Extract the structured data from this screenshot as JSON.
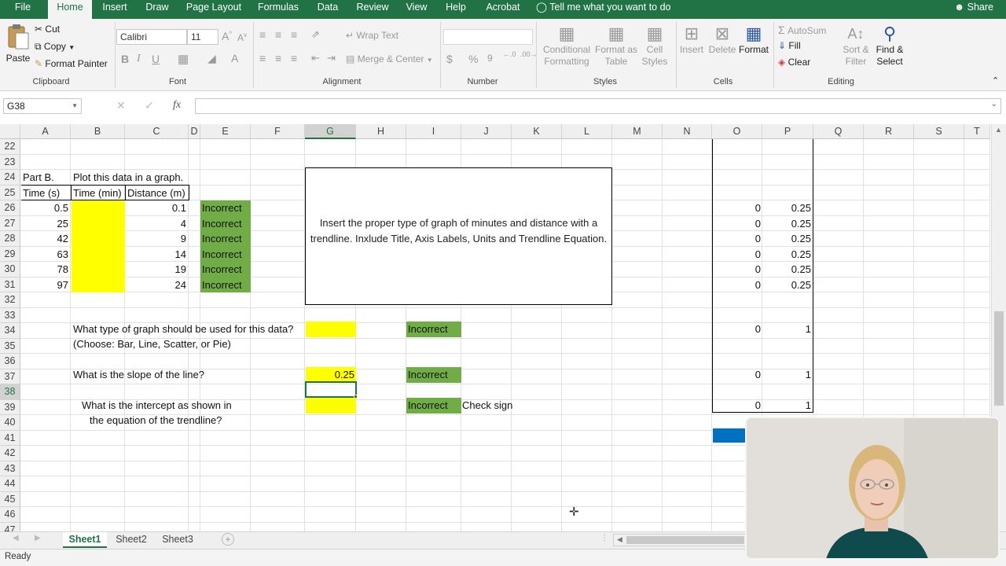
{
  "menu": {
    "tabs": [
      "File",
      "Home",
      "Insert",
      "Draw",
      "Page Layout",
      "Formulas",
      "Data",
      "Review",
      "View",
      "Help",
      "Acrobat"
    ],
    "active_tab": "Home",
    "tell_me": "Tell me what you want to do",
    "share": "Share"
  },
  "ribbon": {
    "clipboard": {
      "paste": "Paste",
      "cut": "Cut",
      "copy": "Copy",
      "format_painter": "Format Painter",
      "label": "Clipboard"
    },
    "font": {
      "name": "Calibri",
      "size": "11",
      "bold": "B",
      "italic": "I",
      "underline": "U",
      "label": "Font"
    },
    "alignment": {
      "wrap_text": "Wrap Text",
      "merge_center": "Merge & Center",
      "label": "Alignment"
    },
    "number": {
      "format": "",
      "currency": "$",
      "percent": "%",
      "comma": "9",
      "label": "Number"
    },
    "styles": {
      "conditional_1": "Conditional",
      "conditional_2": "Formatting",
      "format_as_1": "Format as",
      "format_as_2": "Table",
      "cell_styles_1": "Cell",
      "cell_styles_2": "Styles",
      "label": "Styles"
    },
    "cells": {
      "insert": "Insert",
      "delete": "Delete",
      "format": "Format",
      "label": "Cells"
    },
    "editing": {
      "autosum": "AutoSum",
      "fill": "Fill",
      "clear": "Clear",
      "sort_1": "Sort &",
      "sort_2": "Filter",
      "find_1": "Find &",
      "find_2": "Select",
      "label": "Editing"
    }
  },
  "formula_bar": {
    "name_box": "G38",
    "fx": "fx",
    "formula": ""
  },
  "columns": [
    "A",
    "B",
    "C",
    "D",
    "E",
    "F",
    "G",
    "H",
    "I",
    "J",
    "K",
    "L",
    "M",
    "N",
    "O",
    "P",
    "Q",
    "R",
    "S",
    "T"
  ],
  "selected_column": "G",
  "rows": [
    "22",
    "23",
    "24",
    "25",
    "26",
    "27",
    "28",
    "29",
    "30",
    "31",
    "32",
    "33",
    "34",
    "35",
    "36",
    "37",
    "38",
    "39",
    "40",
    "41",
    "42",
    "43",
    "44",
    "45",
    "46",
    "47"
  ],
  "selected_row": "38",
  "cells": {
    "a24": "Part B.",
    "b24": "Plot this data in a graph.",
    "a25": "Time (s)",
    "b25": "Time (min)",
    "c25": "Distance (m)",
    "a_values": [
      "0.5",
      "25",
      "42",
      "63",
      "78",
      "97"
    ],
    "c_values": [
      "0.1",
      "4",
      "9",
      "14",
      "19",
      "24"
    ],
    "e_values": [
      "Incorrect",
      "Incorrect",
      "Incorrect",
      "Incorrect",
      "Incorrect",
      "Incorrect"
    ],
    "o_values": [
      "0",
      "0",
      "0",
      "0",
      "0",
      "0"
    ],
    "p_values": [
      "0.25",
      "0.25",
      "0.25",
      "0.25",
      "0.25",
      "0.25"
    ],
    "instruction": "Insert the proper type of graph of minutes and distance with a trendline.  Inxlude Title, Axis Labels, Units and Trendline Equation.",
    "q34": "What type of graph should be used for this data?",
    "q35": "(Choose: Bar, Line, Scatter, or Pie)",
    "i34": "Incorrect",
    "o34": "0",
    "p34": "1",
    "q37": "What is the slope of the line?",
    "g37": "0.25",
    "i37": "Incorrect",
    "o37": "0",
    "p37": "1",
    "q39": "What is the intercept as shown in",
    "q40": "the equation of the trendline?",
    "i39": "Incorrect",
    "j39": "Check sign",
    "o39": "0",
    "p39": "1"
  },
  "sheets": [
    "Sheet1",
    "Sheet2",
    "Sheet3"
  ],
  "active_sheet": "Sheet1",
  "status": "Ready",
  "colors": {
    "excel_green": "#217346",
    "cell_yellow": "#ffff00",
    "cell_green": "#70ad47",
    "blue_block": "#0070c0"
  }
}
